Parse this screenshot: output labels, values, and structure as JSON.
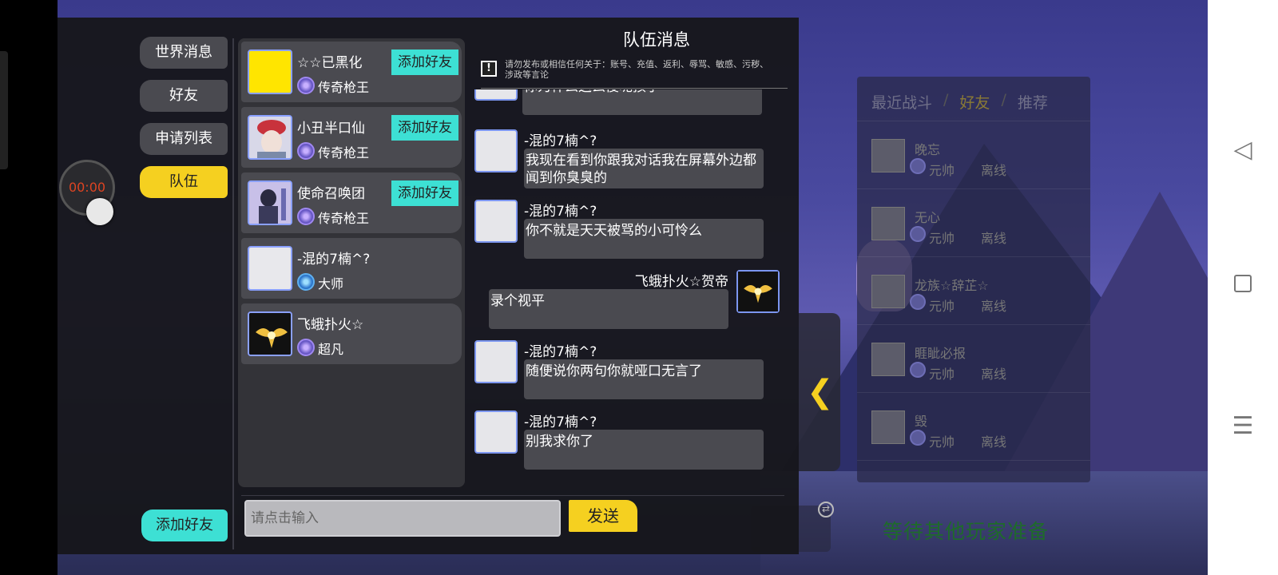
{
  "side_tabs": {
    "world": "世界消息",
    "friends": "好友",
    "requests": "申请列表",
    "team": "队伍"
  },
  "add_friend_bottom": "添加好友",
  "friends": [
    {
      "name": "☆☆已黑化",
      "rank": "传奇枪王",
      "add_label": "添加好友",
      "avatar_color": "#ffe500"
    },
    {
      "name": "小丑半口仙",
      "rank": "传奇枪王",
      "add_label": "添加好友",
      "avatar_color": "#d8d8e8"
    },
    {
      "name": "使命召唤团",
      "rank": "传奇枪王",
      "add_label": "添加好友",
      "avatar_color": "#b8b0e0"
    },
    {
      "name": "-混的7楠^?",
      "rank": "大师"
    },
    {
      "name": "飞蛾扑火☆",
      "rank": "超凡",
      "avatar_color": "#111111"
    }
  ],
  "chat": {
    "title": "队伍消息",
    "notice_icon": "!",
    "notice": "请勿发布或相信任何关于：账号、充值、返利、辱骂、敏感、污秽、涉政等言论",
    "messages": [
      {
        "sender": "",
        "text": "你为什么这么傻呢孩子"
      },
      {
        "sender": "-混的7楠^?",
        "text": "我现在看到你跟我对话我在屏幕外边都闻到你臭臭的"
      },
      {
        "sender": "-混的7楠^?",
        "text": "你不就是天天被骂的小可怜么"
      },
      {
        "sender": "飞蛾扑火☆贺帝",
        "text": "录个视平"
      },
      {
        "sender": "-混的7楠^?",
        "text": "随便说你两句你就哑口无言了"
      },
      {
        "sender": "-混的7楠^?",
        "text": "别我求你了"
      }
    ],
    "input_placeholder": "请点击输入",
    "send_label": "发送"
  },
  "timer": "00:00",
  "right_panel": {
    "tabs": [
      "最近战斗",
      "好友",
      "推荐"
    ],
    "separator": "/",
    "rows": [
      {
        "name": "晚忘",
        "rank": "元帅",
        "status": "离线"
      },
      {
        "name": "无心",
        "rank": "元帅",
        "status": "离线"
      },
      {
        "name": "龙族☆辞芷☆",
        "rank": "元帅",
        "status": "离线"
      },
      {
        "name": "睚眦必报",
        "rank": "元帅",
        "status": "离线"
      },
      {
        "name": "毁",
        "rank": "元帅",
        "status": "离线"
      }
    ]
  },
  "waiting_text": "等待其他玩家准备",
  "icons": {
    "back": "◁",
    "menu": "☰",
    "collapse": "❮",
    "swap": "⇄"
  },
  "colors": {
    "accent_yellow": "#f5d020",
    "accent_cyan": "#3de0d4"
  }
}
